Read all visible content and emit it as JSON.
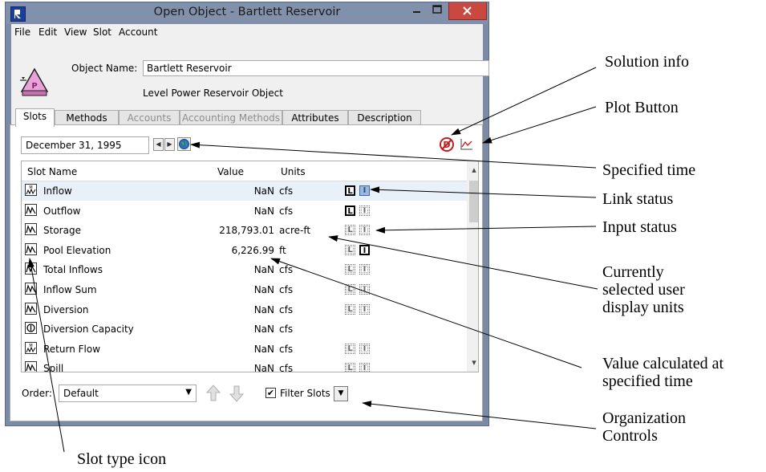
{
  "window": {
    "title": "Open Object - Bartlett Reservoir",
    "menu": [
      "File",
      "Edit",
      "View",
      "Slot",
      "Account"
    ],
    "object_name_label": "Object Name:",
    "object_name_value": "Bartlett Reservoir",
    "object_type": "Level Power Reservoir Object",
    "object_icon_letter": "P",
    "tabs": [
      {
        "label": "Slots",
        "selected": true,
        "enabled": true
      },
      {
        "label": "Methods",
        "selected": false,
        "enabled": true
      },
      {
        "label": "Accounts",
        "selected": false,
        "enabled": false
      },
      {
        "label": "Accounting Methods",
        "selected": false,
        "enabled": false
      },
      {
        "label": "Attributes",
        "selected": false,
        "enabled": true
      },
      {
        "label": "Description",
        "selected": false,
        "enabled": true
      }
    ],
    "date": "December 31, 1995",
    "table": {
      "headers": {
        "name": "Slot Name",
        "value": "Value",
        "units": "Units"
      },
      "rows": [
        {
          "name": "Inflow",
          "value": "NaN",
          "units": "cfs",
          "icon": "multi-series-slot-icon",
          "link": "on",
          "input": "highlight",
          "selected": true
        },
        {
          "name": "Outflow",
          "value": "NaN",
          "units": "cfs",
          "icon": "series-slot-icon",
          "link": "on",
          "input": "off"
        },
        {
          "name": "Storage",
          "value": "218,793.01",
          "units": "acre-ft",
          "icon": "series-slot-icon",
          "link": "off",
          "input": "off"
        },
        {
          "name": "Pool Elevation",
          "value": "6,226.99",
          "units": "ft",
          "icon": "series-slot-icon",
          "link": "off",
          "input": "on"
        },
        {
          "name": "Total Inflows",
          "value": "NaN",
          "units": "cfs",
          "icon": "series-slot-icon",
          "link": "off",
          "input": "off"
        },
        {
          "name": "Inflow Sum",
          "value": "NaN",
          "units": "cfs",
          "icon": "series-slot-icon",
          "link": "off",
          "input": "off"
        },
        {
          "name": "Diversion",
          "value": "NaN",
          "units": "cfs",
          "icon": "series-slot-icon",
          "link": "off",
          "input": "off"
        },
        {
          "name": "Diversion Capacity",
          "value": "NaN",
          "units": "cfs",
          "icon": "scalar-slot-icon",
          "link": "none",
          "input": "none"
        },
        {
          "name": "Return Flow",
          "value": "NaN",
          "units": "cfs",
          "icon": "multi-series-slot-icon",
          "link": "off",
          "input": "off"
        },
        {
          "name": "Spill",
          "value": "NaN",
          "units": "cfs",
          "icon": "series-slot-icon",
          "link": "off",
          "input": "off"
        }
      ]
    },
    "status_letters": {
      "link": "L",
      "input": "I"
    },
    "order_label": "Order:",
    "order_value": "Default",
    "filter_label": "Filter Slots",
    "filter_checked": true
  },
  "annotations": {
    "solution_info": "Solution info",
    "plot_button": "Plot Button",
    "specified_time": "Specified time",
    "link_status": "Link status",
    "input_status": "Input status",
    "units_line1": "Currently",
    "units_line2": "selected user",
    "units_line3": "display units",
    "value_line1": "Value calculated at",
    "value_line2": "specified time",
    "org_line1": "Organization",
    "org_line2": "Controls",
    "slot_type_icon": "Slot type icon"
  },
  "colors": {
    "title_bar": "#8190ab",
    "close_button": "#c9483f",
    "selected_row": "#e8f0fa",
    "link_highlight": "#9cb9dd"
  }
}
